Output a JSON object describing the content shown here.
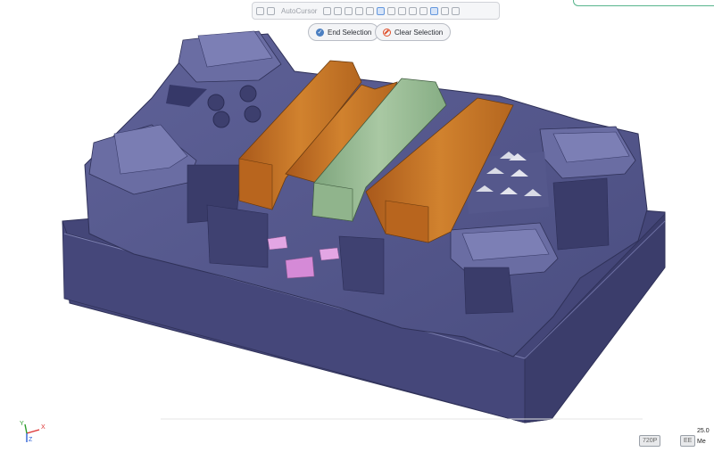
{
  "toolbar": {
    "autocursor_label": "AutoCursor"
  },
  "selection": {
    "end_label": "End Selection",
    "clear_label": "Clear Selection"
  },
  "axes": {
    "x": "X",
    "y": "Y",
    "z": "Z"
  },
  "status": {
    "quality_badge": "720P",
    "aux_badge": "EE",
    "value_text": "25.0",
    "unit_text": "Me"
  },
  "colors": {
    "model_body": "#4a4c7e",
    "model_top": "#5a5d92",
    "orange_rib": "#c26f22",
    "green_rib": "#8fb48a",
    "pink_feature": "#d58ad7"
  }
}
